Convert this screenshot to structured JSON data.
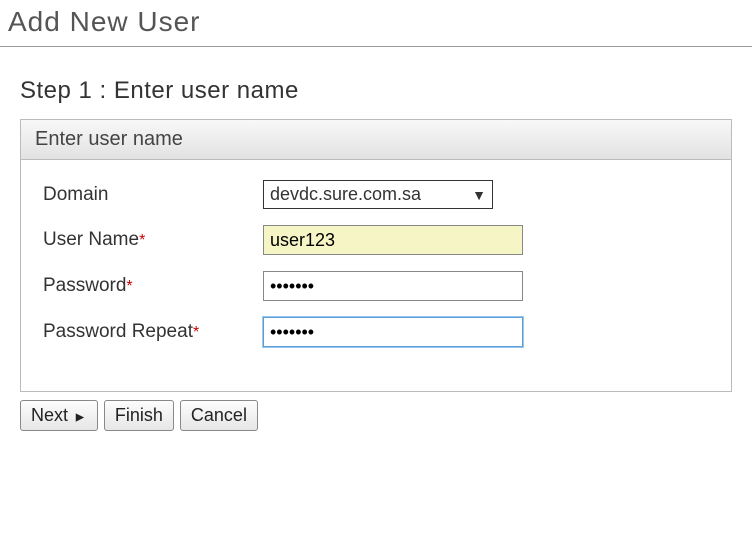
{
  "page": {
    "title": "Add New User",
    "step_heading": "Step 1 : Enter user name"
  },
  "panel": {
    "header": "Enter user name"
  },
  "form": {
    "domain": {
      "label": "Domain",
      "required": false,
      "selected": "devdc.sure.com.sa"
    },
    "username": {
      "label": "User Name",
      "required": true,
      "value": "user123"
    },
    "password": {
      "label": "Password",
      "required": true,
      "value": "•••••••"
    },
    "password_repeat": {
      "label": "Password Repeat",
      "required": true,
      "value": "•••••••"
    }
  },
  "buttons": {
    "next": "Next",
    "finish": "Finish",
    "cancel": "Cancel"
  },
  "symbols": {
    "required_mark": "*",
    "dropdown_arrow": "▼",
    "next_arrow": "►"
  }
}
